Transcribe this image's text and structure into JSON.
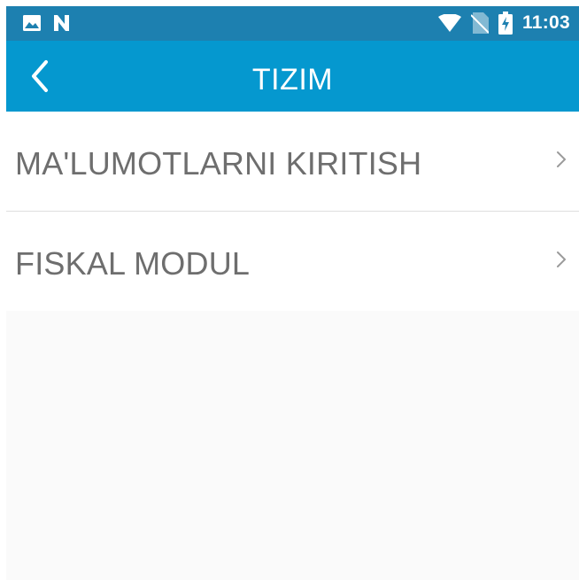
{
  "status_bar": {
    "time": "11:03",
    "left_icons": [
      "image-icon",
      "n-notification-icon"
    ],
    "right_icons": [
      "wifi-icon",
      "no-sim-icon",
      "battery-charging-icon"
    ]
  },
  "app_bar": {
    "title": "TIZIM",
    "back_icon": "chevron-left-icon"
  },
  "menu": {
    "items": [
      {
        "label": "MA'LUMOTLARNI KIRITISH",
        "icon": "chevron-right-icon"
      },
      {
        "label": "FISKAL MODUL",
        "icon": "chevron-right-icon"
      }
    ]
  },
  "colors": {
    "status_bar": "#1d80b0",
    "app_bar": "#0598cf",
    "text": "#6e6e6e",
    "divider": "#dedede",
    "background": "#fafafa"
  }
}
